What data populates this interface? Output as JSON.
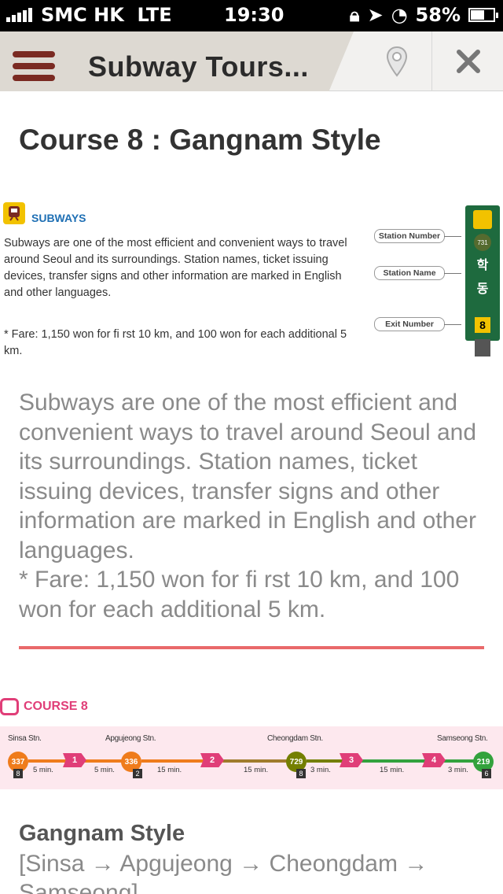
{
  "status_bar": {
    "carrier": "SMC HK",
    "network": "LTE",
    "time": "19:30",
    "battery": "58%"
  },
  "nav": {
    "title": "Subway Tours...",
    "menu_icon": "hamburger-icon",
    "pin_icon": "map-pin-icon",
    "close_icon": "close-icon"
  },
  "page": {
    "heading": "Course 8 : Gangnam Style"
  },
  "infobox": {
    "title": "SUBWAYS",
    "text": "Subways are one of the most efficient and convenient ways to travel around Seoul and its surroundings. Station names, ticket issuing devices, transfer signs and other information are marked in English and other languages.",
    "fare": "* Fare: 1,150 won for fi rst 10 km, and 100 won for each additional 5 km.",
    "callouts": [
      "Station Number",
      "Station Name",
      "Exit Number"
    ],
    "sign_number": "731",
    "sign_chars": [
      "학",
      "동"
    ],
    "sign_exit": "8"
  },
  "body": {
    "paragraph": "Subways are one of the most efficient and convenient ways to travel around Seoul and its surroundings. Station names, ticket issuing devices, transfer signs and other information are marked in English and other languages.",
    "fare": "* Fare: 1,150 won for fi rst 10 km, and 100 won for each additional 5 km."
  },
  "course": {
    "label": "COURSE 8",
    "stations": [
      {
        "name": "Sinsa Stn.",
        "number": "337",
        "exit": "8"
      },
      {
        "name": "Apgujeong Stn.",
        "number": "336",
        "exit": "2"
      },
      {
        "name": "Cheongdam Stn.",
        "number": "729",
        "exit": "8"
      },
      {
        "name": "Samseong Stn.",
        "number": "219",
        "exit": "6"
      }
    ],
    "steps": [
      "1",
      "2",
      "3",
      "4"
    ],
    "times": [
      "5 min.",
      "5 min.",
      "15 min.",
      "15 min.",
      "3 min.",
      "15 min.",
      "3 min."
    ],
    "colors": {
      "line3": "#ef7c1c",
      "line7": "#747f00",
      "line2": "#33a23d",
      "step": "#e03e78"
    }
  },
  "footer": {
    "title": "Gangnam Style",
    "route": "[Sinsa → Apgujeong → Cheongdam → Samseong]"
  }
}
